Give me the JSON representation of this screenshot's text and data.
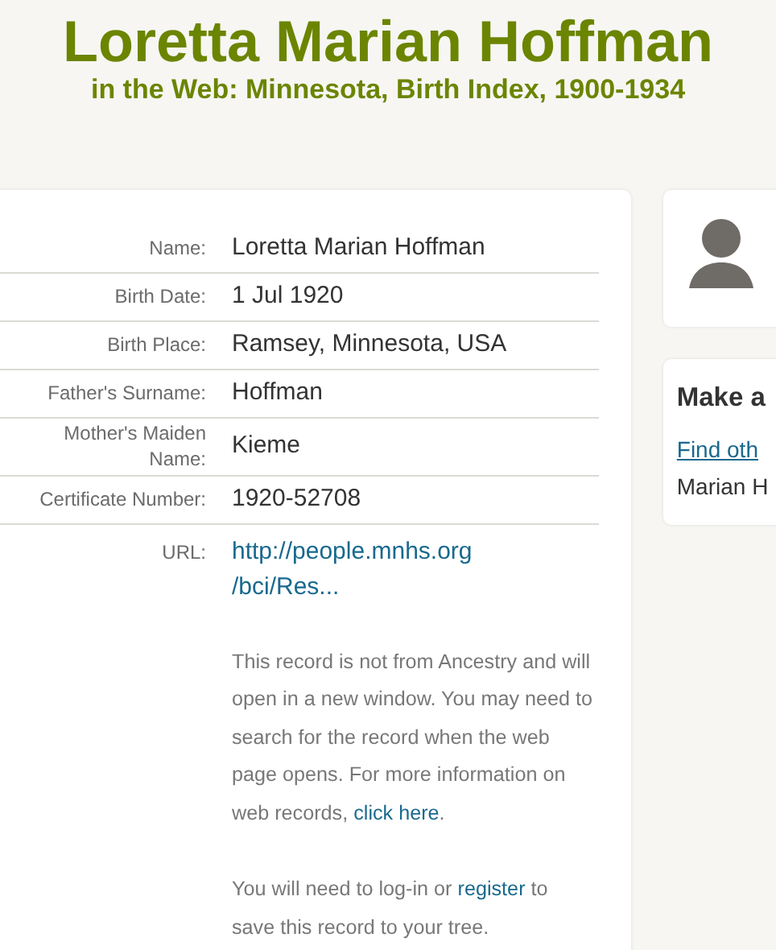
{
  "header": {
    "title": "Loretta Marian Hoffman",
    "subtitle": "in the Web: Minnesota, Birth Index, 1900-1934"
  },
  "fields": [
    {
      "label": "Name:",
      "value": "Loretta Marian Hoffman"
    },
    {
      "label": "Birth Date:",
      "value": "1 Jul 1920"
    },
    {
      "label": "Birth Place:",
      "value": "Ramsey, Minnesota, USA"
    },
    {
      "label": "Father's Surname:",
      "value": "Hoffman"
    },
    {
      "label": "Mother's Maiden Name:",
      "value": "Kieme"
    },
    {
      "label": "Certificate Number:",
      "value": "1920-52708"
    }
  ],
  "url": {
    "label": "URL:",
    "lines": [
      "http://people.mnhs.org",
      "/bci/Res..."
    ]
  },
  "notes": [
    {
      "before": "This record is not from Ancestry and will open in a new window. You may need to search for the record when the web page opens. For more information on web records, ",
      "link": "click here",
      "after": "."
    },
    {
      "before": "You will need to log-in or ",
      "link": "register",
      "after": " to save this record to your tree."
    }
  ],
  "side": {
    "heading": "Make a",
    "link": "Find oth",
    "text": "Marian H"
  }
}
